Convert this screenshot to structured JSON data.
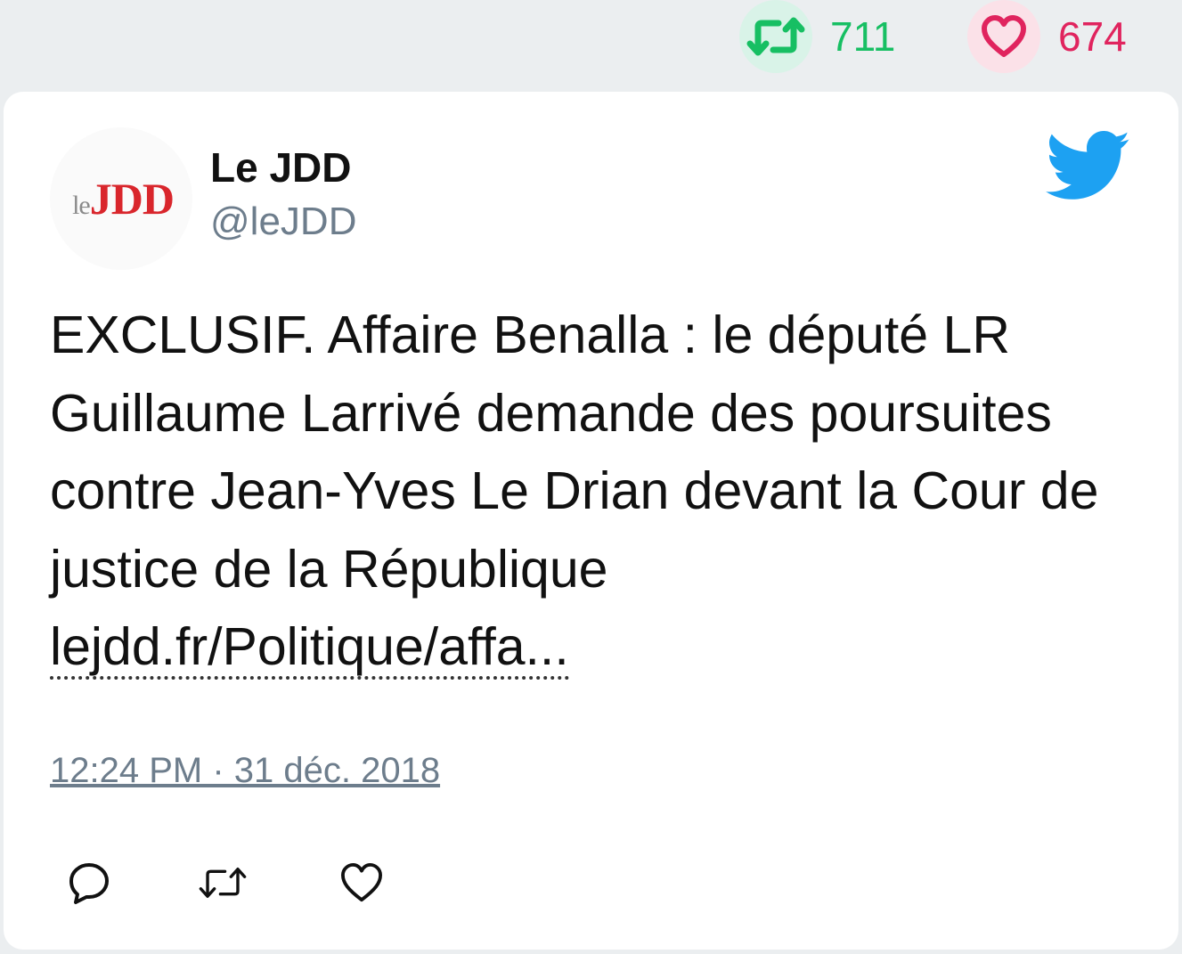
{
  "stats": {
    "retweet_count": "711",
    "like_count": "674"
  },
  "author": {
    "avatar_logo_prefix": "le",
    "avatar_logo_main": "JDD",
    "name": "Le JDD",
    "handle": "@leJDD"
  },
  "tweet": {
    "text": "EXCLUSIF. Affaire Benalla : le député LR Guillaume Larrivé demande des poursuites contre Jean-Yves Le Drian devant la Cour de justice de la République ",
    "link": "lejdd.fr/Politique/affa...",
    "timestamp": "12:24 PM · 31 déc. 2018"
  },
  "icons": {
    "retweet": "retweet-icon",
    "like": "heart-icon",
    "reply": "reply-icon",
    "brand": "twitter-bird-icon"
  },
  "colors": {
    "retweet": "#17bf63",
    "like": "#e0245e",
    "twitter_blue": "#1da1f2",
    "muted": "#6d7d8c"
  }
}
